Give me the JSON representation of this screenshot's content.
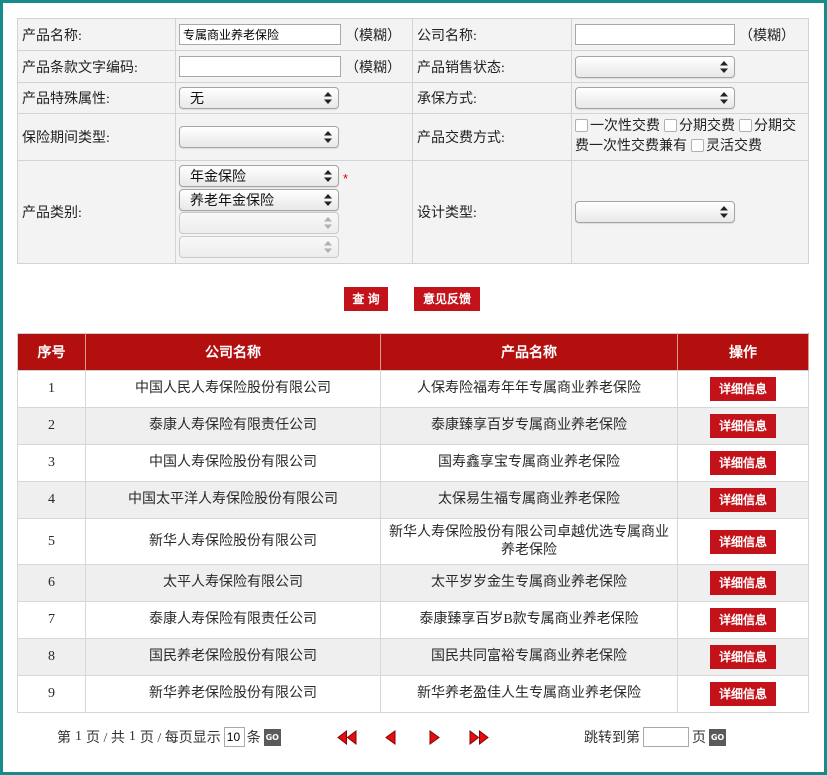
{
  "search_form": {
    "product_name": {
      "label": "产品名称:",
      "value": "专属商业养老保险",
      "hint": "（模糊）"
    },
    "company_name": {
      "label": "公司名称:",
      "value": "",
      "hint": "（模糊）"
    },
    "clause_code": {
      "label": "产品条款文字编码:",
      "value": "",
      "hint": "（模糊）"
    },
    "sale_status": {
      "label": "产品销售状态:",
      "value": ""
    },
    "special_attribute": {
      "label": "产品特殊属性:",
      "value": "无"
    },
    "underwriting_method": {
      "label": "承保方式:",
      "value": ""
    },
    "period_type": {
      "label": "保险期间类型:",
      "value": ""
    },
    "payment_method": {
      "label": "产品交费方式:",
      "options": [
        {
          "label": "一次性交费",
          "checked": false
        },
        {
          "label": "分期交费",
          "checked": false
        },
        {
          "label": "分期交费一次性交费兼有",
          "checked": false
        },
        {
          "label": "灵活交费",
          "checked": false
        }
      ]
    },
    "category": {
      "label": "产品类别:",
      "level1": "年金保险",
      "level2": "养老年金保险",
      "level3": "",
      "level4": "",
      "required_mark": "*"
    },
    "design_type": {
      "label": "设计类型:",
      "value": ""
    }
  },
  "actions": {
    "query_label": "查 询",
    "feedback_label": "意见反馈"
  },
  "results": {
    "headers": {
      "index": "序号",
      "company": "公司名称",
      "product": "产品名称",
      "action": "操作"
    },
    "rows": [
      {
        "index": "1",
        "company": "中国人民人寿保险股份有限公司",
        "product": "人保寿险福寿年年专属商业养老保险",
        "action": "详细信息"
      },
      {
        "index": "2",
        "company": "泰康人寿保险有限责任公司",
        "product": "泰康臻享百岁专属商业养老保险",
        "action": "详细信息"
      },
      {
        "index": "3",
        "company": "中国人寿保险股份有限公司",
        "product": "国寿鑫享宝专属商业养老保险",
        "action": "详细信息"
      },
      {
        "index": "4",
        "company": "中国太平洋人寿保险股份有限公司",
        "product": "太保易生福专属商业养老保险",
        "action": "详细信息"
      },
      {
        "index": "5",
        "company": "新华人寿保险股份有限公司",
        "product": "新华人寿保险股份有限公司卓越优选专属商业养老保险",
        "action": "详细信息"
      },
      {
        "index": "6",
        "company": "太平人寿保险有限公司",
        "product": "太平岁岁金生专属商业养老保险",
        "action": "详细信息"
      },
      {
        "index": "7",
        "company": "泰康人寿保险有限责任公司",
        "product": "泰康臻享百岁B款专属商业养老保险",
        "action": "详细信息"
      },
      {
        "index": "8",
        "company": "国民养老保险股份有限公司",
        "product": "国民共同富裕专属商业养老保险",
        "action": "详细信息"
      },
      {
        "index": "9",
        "company": "新华养老保险股份有限公司",
        "product": "新华养老盈佳人生专属商业养老保险",
        "action": "详细信息"
      }
    ]
  },
  "pagination": {
    "page_prefix": "第",
    "current_page": "1",
    "total_prefix": "页 / 共",
    "total_pages": "1",
    "size_prefix": "页 / 每页显示",
    "page_size": "10",
    "size_unit": "条",
    "go_label": "GO",
    "jump_label": "跳转到第",
    "jump_value": "",
    "jump_unit": "页"
  },
  "icons": {
    "select_arrows": "select-arrows-icon",
    "checkbox": "checkbox-icon",
    "first_page": "first-page-icon",
    "prev_page": "prev-page-icon",
    "next_page": "next-page-icon",
    "last_page": "last-page-icon"
  },
  "colors": {
    "frame_border": "#178a8c",
    "table_header": "#b30f0f",
    "primary_button": "#c4121a",
    "required_mark": "#e00000",
    "alt_row": "#efefef"
  }
}
